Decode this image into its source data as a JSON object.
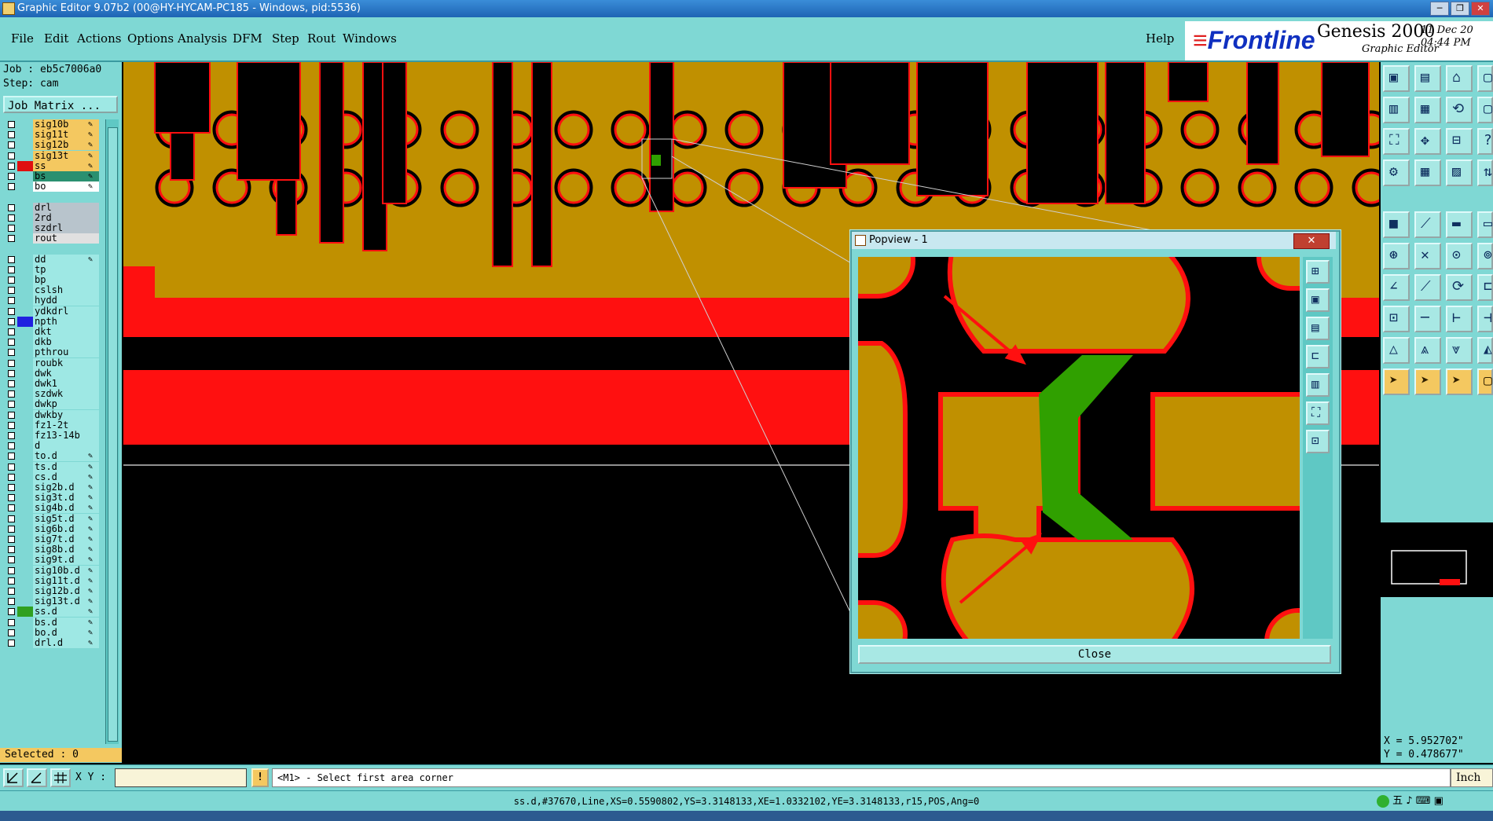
{
  "window": {
    "title": "Graphic Editor 9.07b2 (00@HY-HYCAM-PC185 - Windows, pid:5536)",
    "controls": [
      "─",
      "❐",
      "✕"
    ]
  },
  "menu": {
    "items": [
      "File",
      "Edit",
      "Actions",
      "Options",
      "Analysis",
      "DFM",
      "Step",
      "Rout",
      "Windows"
    ],
    "help": "Help"
  },
  "logo": {
    "brand": "Frontline",
    "product": "Genesis 2000",
    "subtitle": "Graphic Editor",
    "date": "11 Dec 20",
    "time": "04:44 PM"
  },
  "job": {
    "job_label": "Job : eb5c7006a0",
    "step_label": "Step: cam",
    "job_matrix": "Job Matrix ..."
  },
  "layers": [
    {
      "name": "sig10b",
      "color": "#f4c860",
      "swatch": "",
      "editable": true
    },
    {
      "name": "sig11t",
      "color": "#f4c860",
      "swatch": "",
      "editable": true
    },
    {
      "name": "sig12b",
      "color": "#f4c860",
      "swatch": "",
      "editable": true
    },
    {
      "name": "sig13t",
      "color": "#f4c860",
      "swatch": "",
      "editable": true
    },
    {
      "name": "ss",
      "color": "#f4c860",
      "swatch": "#e01010",
      "editable": true
    },
    {
      "name": "bs",
      "color": "#2a9070",
      "swatch": "",
      "editable": true
    },
    {
      "name": "bo",
      "color": "#ffffff",
      "swatch": "",
      "editable": true
    },
    {
      "name": "",
      "color": "",
      "swatch": "",
      "editable": false
    },
    {
      "name": "drl",
      "color": "#b8c4cc",
      "swatch": "",
      "editable": false
    },
    {
      "name": "2rd",
      "color": "#b8c4cc",
      "swatch": "",
      "editable": false
    },
    {
      "name": "szdrl",
      "color": "#b8c4cc",
      "swatch": "",
      "editable": false
    },
    {
      "name": "rout",
      "color": "#e0e0e0",
      "swatch": "",
      "editable": false
    },
    {
      "name": "",
      "color": "",
      "swatch": "",
      "editable": false
    },
    {
      "name": "dd",
      "color": "#9ee8e4",
      "swatch": "",
      "editable": true
    },
    {
      "name": "tp",
      "color": "#9ee8e4",
      "swatch": "",
      "editable": false
    },
    {
      "name": "bp",
      "color": "#9ee8e4",
      "swatch": "",
      "editable": false
    },
    {
      "name": "cslsh",
      "color": "#9ee8e4",
      "swatch": "",
      "editable": false
    },
    {
      "name": "hydd",
      "color": "#9ee8e4",
      "swatch": "",
      "editable": false
    },
    {
      "name": "ydkdrl",
      "color": "#9ee8e4",
      "swatch": "",
      "editable": false
    },
    {
      "name": "npth",
      "color": "#9ee8e4",
      "swatch": "#2020e0",
      "editable": false
    },
    {
      "name": "dkt",
      "color": "#9ee8e4",
      "swatch": "",
      "editable": false
    },
    {
      "name": "dkb",
      "color": "#9ee8e4",
      "swatch": "",
      "editable": false
    },
    {
      "name": "pthrou",
      "color": "#9ee8e4",
      "swatch": "",
      "editable": false
    },
    {
      "name": "roubk",
      "color": "#9ee8e4",
      "swatch": "",
      "editable": false
    },
    {
      "name": "dwk",
      "color": "#9ee8e4",
      "swatch": "",
      "editable": false
    },
    {
      "name": "dwk1",
      "color": "#9ee8e4",
      "swatch": "",
      "editable": false
    },
    {
      "name": "szdwk",
      "color": "#9ee8e4",
      "swatch": "",
      "editable": false
    },
    {
      "name": "dwkp",
      "color": "#9ee8e4",
      "swatch": "",
      "editable": false
    },
    {
      "name": "dwkby",
      "color": "#9ee8e4",
      "swatch": "",
      "editable": false
    },
    {
      "name": "fz1-2t",
      "color": "#9ee8e4",
      "swatch": "",
      "editable": false
    },
    {
      "name": "fz13-14b",
      "color": "#9ee8e4",
      "swatch": "",
      "editable": false
    },
    {
      "name": "d",
      "color": "#9ee8e4",
      "swatch": "",
      "editable": false
    },
    {
      "name": "to.d",
      "color": "#9ee8e4",
      "swatch": "",
      "editable": true
    },
    {
      "name": "ts.d",
      "color": "#9ee8e4",
      "swatch": "",
      "editable": true
    },
    {
      "name": "cs.d",
      "color": "#9ee8e4",
      "swatch": "",
      "editable": true
    },
    {
      "name": "sig2b.d",
      "color": "#9ee8e4",
      "swatch": "",
      "editable": true
    },
    {
      "name": "sig3t.d",
      "color": "#9ee8e4",
      "swatch": "",
      "editable": true
    },
    {
      "name": "sig4b.d",
      "color": "#9ee8e4",
      "swatch": "",
      "editable": true
    },
    {
      "name": "sig5t.d",
      "color": "#9ee8e4",
      "swatch": "",
      "editable": true
    },
    {
      "name": "sig6b.d",
      "color": "#9ee8e4",
      "swatch": "",
      "editable": true
    },
    {
      "name": "sig7t.d",
      "color": "#9ee8e4",
      "swatch": "",
      "editable": true
    },
    {
      "name": "sig8b.d",
      "color": "#9ee8e4",
      "swatch": "",
      "editable": true
    },
    {
      "name": "sig9t.d",
      "color": "#9ee8e4",
      "swatch": "",
      "editable": true
    },
    {
      "name": "sig10b.d",
      "color": "#9ee8e4",
      "swatch": "",
      "editable": true
    },
    {
      "name": "sig11t.d",
      "color": "#9ee8e4",
      "swatch": "",
      "editable": true
    },
    {
      "name": "sig12b.d",
      "color": "#9ee8e4",
      "swatch": "",
      "editable": true
    },
    {
      "name": "sig13t.d",
      "color": "#9ee8e4",
      "swatch": "",
      "editable": true
    },
    {
      "name": "ss.d",
      "color": "#9ee8e4",
      "swatch": "#30a020",
      "editable": true
    },
    {
      "name": "bs.d",
      "color": "#9ee8e4",
      "swatch": "",
      "editable": true
    },
    {
      "name": "bo.d",
      "color": "#9ee8e4",
      "swatch": "",
      "editable": true
    },
    {
      "name": "drl.d",
      "color": "#9ee8e4",
      "swatch": "",
      "editable": true
    }
  ],
  "selected_label": "Selected : 0",
  "popview": {
    "title": "Popview - 1",
    "close": "Close"
  },
  "coords": {
    "x": "X = 5.952702\"",
    "y": "Y = 0.478677\""
  },
  "command": {
    "xy_label": "X Y :",
    "xy_value": "",
    "prompt": "<M1> - Select first area corner",
    "units": "Inch"
  },
  "status_text": "ss.d,#37670,Line,XS=0.5590802,YS=3.3148133,XE=1.0332102,YE=3.3148133,r15,POS,Ang=0",
  "tray_text": "五 ♪ ⌨ ▣",
  "colors": {
    "copper": "#c09000",
    "red": "#ff1010",
    "green": "#30a000",
    "panel": "#7fd8d4"
  }
}
